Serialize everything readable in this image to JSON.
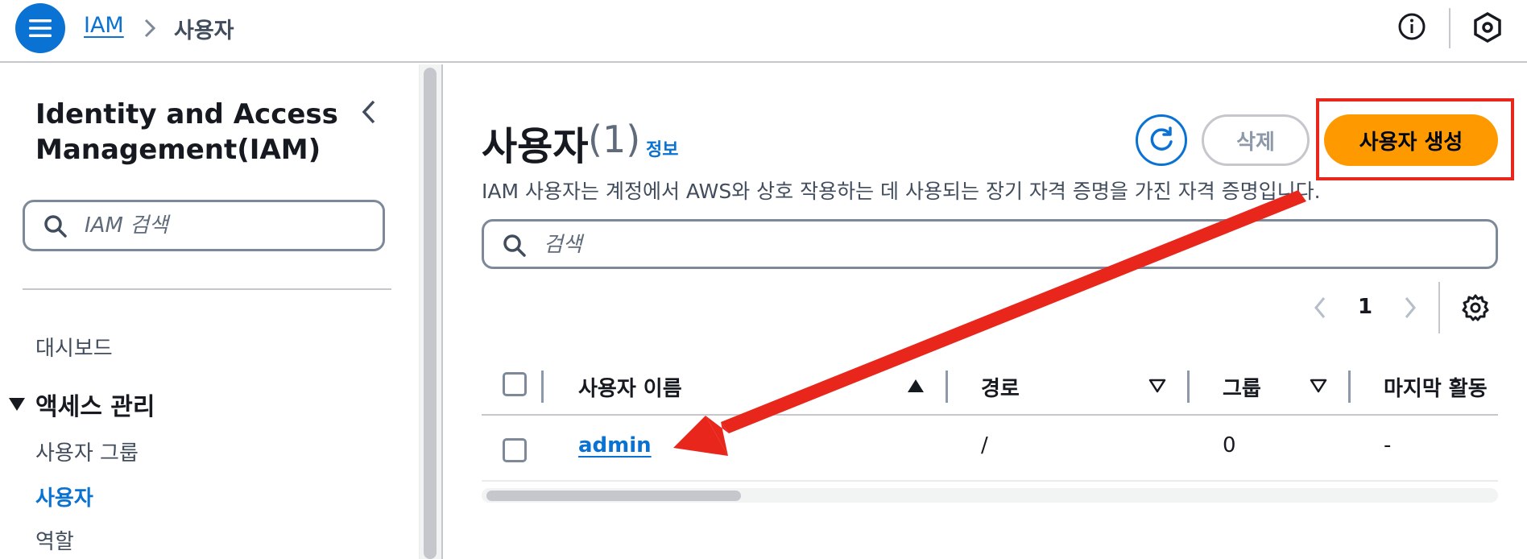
{
  "header": {
    "breadcrumb_root": "IAM",
    "breadcrumb_current": "사용자"
  },
  "sidebar": {
    "title": "Identity and Access Management(IAM)",
    "search_placeholder": "IAM 검색",
    "items": {
      "dashboard": "대시보드",
      "access_section": "액세스 관리",
      "user_groups": "사용자 그룹",
      "users": "사용자",
      "roles": "역할"
    }
  },
  "main": {
    "title": "사용자",
    "count": "(1)",
    "info_link": "정보",
    "delete_label": "삭제",
    "create_label": "사용자 생성",
    "description": "IAM 사용자는 계정에서 AWS와 상호 작용하는 데 사용되는 장기 자격 증명을 가진 자격 증명입니다.",
    "search_placeholder": "검색",
    "pager": {
      "current_page": "1"
    }
  },
  "table": {
    "columns": [
      "사용자 이름",
      "경로",
      "그룹",
      "마지막 활동"
    ],
    "rows": [
      {
        "username": "admin",
        "path": "/",
        "groups": "0",
        "last_activity": "-"
      }
    ]
  },
  "colors": {
    "accent": "#0972d3",
    "primary_button": "#ff9900",
    "annotation": "#e8261c"
  },
  "icons": [
    "menu-icon",
    "chevron-right-icon",
    "info-icon",
    "hexagon-settings-icon",
    "chevron-left-icon",
    "search-icon",
    "caret-down-icon",
    "refresh-icon",
    "gear-icon",
    "sort-asc-icon",
    "sort-desc-icon"
  ]
}
